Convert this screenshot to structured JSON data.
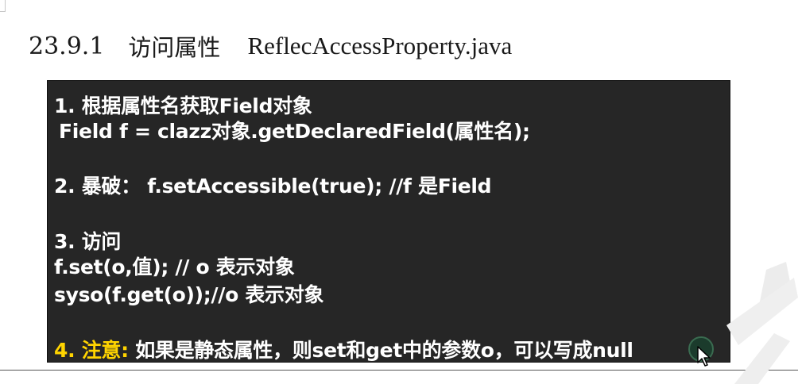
{
  "heading": {
    "number": "23.9.1",
    "title": "访问属性",
    "filename": "ReflecAccessProperty.java"
  },
  "code": {
    "line1": "1. 根据属性名获取Field对象",
    "line2": "Field f = clazz对象.getDeclaredField(属性名);",
    "line3": "2. 暴破： f.setAccessible(true); //f 是Field",
    "line4": "3. 访问",
    "line5": "f.set(o,值); // o 表示对象",
    "line6": "syso(f.get(o));//o 表示对象",
    "line7_prefix": "4. 注意:",
    "line7_text": " 如果是静态属性，则set和get中的参数o，可以写成null"
  },
  "colors": {
    "box_background": "#262626",
    "text": "#ffffff",
    "highlight": "#ffd400"
  },
  "icons": {
    "cursor": "mouse-cursor-icon",
    "watermark": "watermark-shape"
  }
}
